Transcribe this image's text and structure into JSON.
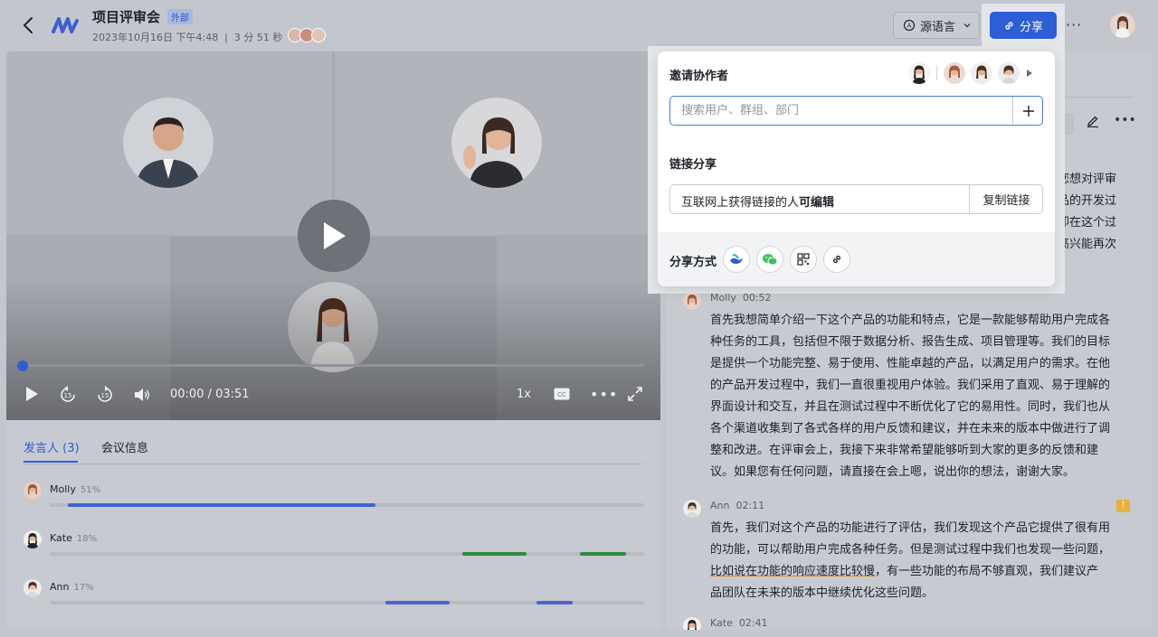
{
  "header": {
    "title": "项目评审会",
    "badge": "外部",
    "date": "2023年10月16日 下午4:48",
    "duration": "3 分 51 秒",
    "lang_label": "源语言",
    "share_label": "分享",
    "more": "···"
  },
  "video": {
    "time": "00:00 / 03:51",
    "speed": "1x",
    "progress": 0.0
  },
  "speakers_panel": {
    "tab_speakers": "发言人 (3)",
    "tab_info": "会议信息",
    "speakers": [
      {
        "name": "Molly",
        "pct": "51%",
        "color": "#3b62d6"
      },
      {
        "name": "Kate",
        "pct": "18%",
        "color": "#2f8a3c"
      },
      {
        "name": "Ann",
        "pct": "17%",
        "color": "#4e65d0"
      }
    ]
  },
  "transcript": {
    "peek_lines": [
      "您想对评审",
      "品的开发过",
      "即在这个过",
      "高兴能再次"
    ],
    "entries": [
      {
        "speaker": "Molly",
        "time": "00:52",
        "text": "首先我想简单介绍一下这个产品的功能和特点，它是一款能够帮助用户完成各种任务的工具，包括但不限于数据分析、报告生成、项目管理等。我们的目标是提供一个功能完整、易于使用、性能卓越的产品，以满足用户的需求。在他的产品开发过程中，我们一直很重视用户体验。我们采用了直观、易于理解的界面设计和交互，并且在测试过程中不断优化了它的易用性。同时，我们也从各个渠道收集到了各式各样的用户反馈和建议，并在未来的版本中做进行了调整和改进。在评审会上，我接下来非常希望能够听到大家的更多的反馈和建议。如果您有任何问题，请直接在会上嗯，说出你的想法，谢谢大家。"
      },
      {
        "speaker": "Ann",
        "time": "02:11",
        "text_before": "首先，我们对这个产品的功能进行了评估，我们发现这个产品它提供了很有用的功能，可以帮助用户完成各种任务。但是测试过程中我们也发现一些问题，",
        "text_underlined": "比如说在功能的响应速度比较慢",
        "text_after": "，有一些功能的布局不够直观，我们建议产品团队在未来的版本中继续优化这些问题。"
      },
      {
        "speaker": "Kate",
        "time": "02:41"
      }
    ]
  },
  "share_popover": {
    "invite_title": "邀请协作者",
    "search_placeholder": "搜索用户、群组、部门",
    "link_title": "链接分享",
    "link_perm_prefix": "互联网上获得链接的人",
    "link_perm_bold": "可编辑",
    "copy_label": "复制链接",
    "share_way_label": "分享方式",
    "share_ways": [
      "feishu-icon",
      "wechat-icon",
      "qrcode-icon",
      "link-icon"
    ]
  }
}
